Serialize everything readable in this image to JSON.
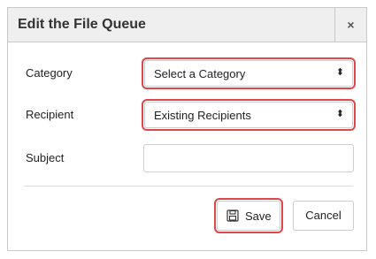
{
  "dialog": {
    "title": "Edit the File Queue",
    "close_label": "×"
  },
  "form": {
    "category": {
      "label": "Category",
      "selected": "Select a Category",
      "arrows": "⬍"
    },
    "recipient": {
      "label": "Recipient",
      "selected": "Existing Recipients",
      "arrows": "⬍"
    },
    "subject": {
      "label": "Subject",
      "value": ""
    }
  },
  "actions": {
    "save_label": "Save",
    "cancel_label": "Cancel",
    "save_icon": "floppy-disk-icon"
  },
  "colors": {
    "highlight": "#e0474c",
    "header_bg": "#efefef"
  }
}
